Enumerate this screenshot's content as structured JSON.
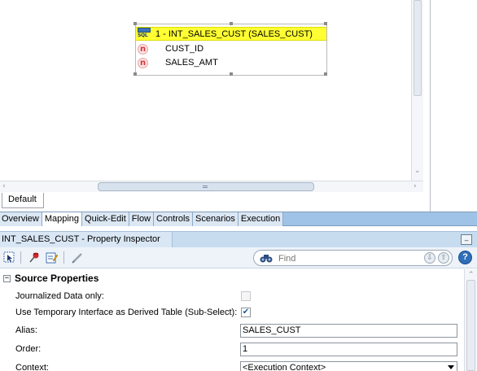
{
  "diagram": {
    "datastore": {
      "title": "1 - INT_SALES_CUST (SALES_CUST)",
      "icon": "sql-datastore-icon",
      "columns": [
        {
          "name": "CUST_ID",
          "icon": "numeric-column-icon",
          "icon_glyph": "n"
        },
        {
          "name": "SALES_AMT",
          "icon": "numeric-column-icon",
          "icon_glyph": "n"
        }
      ]
    },
    "sql_icon_text": "SQL",
    "diagram_tab": "Default"
  },
  "editor_tabs": [
    {
      "label": "Overview",
      "active": false
    },
    {
      "label": "Mapping",
      "active": true
    },
    {
      "label": "Quick-Edit",
      "active": false
    },
    {
      "label": "Flow",
      "active": false
    },
    {
      "label": "Controls",
      "active": false
    },
    {
      "label": "Scenarios",
      "active": false
    },
    {
      "label": "Execution",
      "active": false
    }
  ],
  "inspector": {
    "title": "INT_SALES_CUST - Property Inspector",
    "find_placeholder": "Find",
    "help_label": "?",
    "section": {
      "label": "Source Properties",
      "toggle": "−"
    },
    "properties": [
      {
        "label": "Journalized Data only:",
        "type": "checkbox",
        "checked": false,
        "enabled": false
      },
      {
        "label": "Use Temporary Interface as Derived Table (Sub-Select):",
        "type": "checkbox",
        "checked": true,
        "enabled": true
      },
      {
        "label": "Alias:",
        "type": "text",
        "value": "SALES_CUST"
      },
      {
        "label": "Order:",
        "type": "text",
        "value": "1"
      },
      {
        "label": "Context:",
        "type": "select",
        "value": "<Execution Context>"
      }
    ]
  },
  "colors": {
    "node_header": "#ffff33",
    "tab_bar": "#9fc3e6",
    "inspector_header": "#c8dcf0",
    "column_icon": "#d8343a"
  }
}
